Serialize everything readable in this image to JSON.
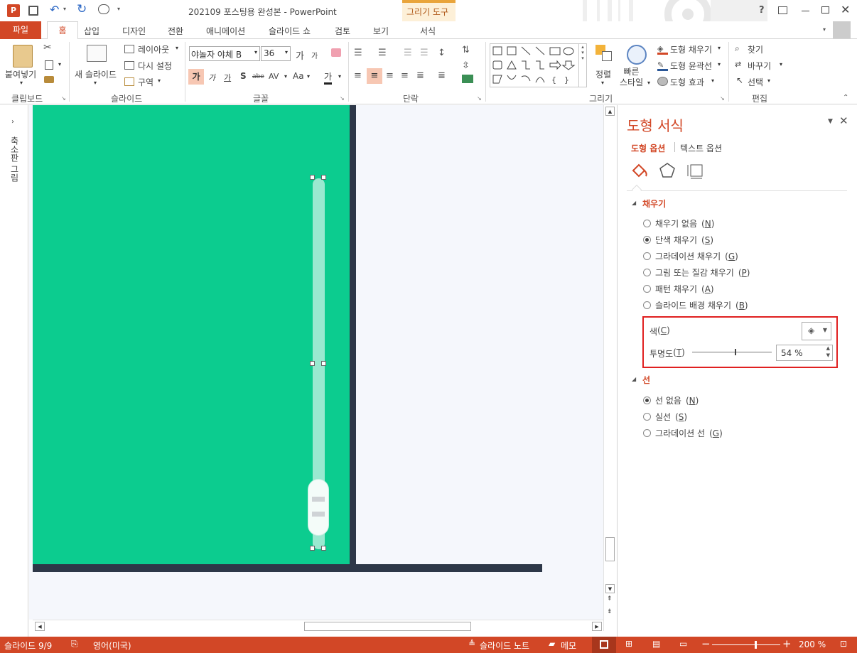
{
  "titlebar": {
    "title": "202109 포스팅용 완성본 - PowerPoint",
    "contextual_group": "그리기 도구",
    "help": "?"
  },
  "tabs": [
    {
      "label": "파일"
    },
    {
      "label": "홈"
    },
    {
      "label": "삽입"
    },
    {
      "label": "디자인"
    },
    {
      "label": "전환"
    },
    {
      "label": "애니메이션"
    },
    {
      "label": "슬라이드 쇼"
    },
    {
      "label": "검토"
    },
    {
      "label": "보기"
    },
    {
      "label": "서식"
    }
  ],
  "ribbon": {
    "clipboard": {
      "paste": "붙여넣기",
      "group": "클립보드"
    },
    "slides": {
      "new_slide": "새 슬라이드",
      "layout": "레이아웃",
      "reset": "다시 설정",
      "section": "구역",
      "group": "슬라이드"
    },
    "font": {
      "font_name": "야놀자 야체 B",
      "font_size": "36",
      "group": "글꼴",
      "grow": "가",
      "shrink": "가",
      "bold": "가",
      "italic": "가",
      "underline": "가",
      "shadow": "S",
      "strike": "abe",
      "spacing": "AV",
      "case": "Aa",
      "color": "가"
    },
    "paragraph": {
      "group": "단락"
    },
    "drawing": {
      "arrange": "정렬",
      "quick_styles": "빠른\n스타일",
      "fill": "도형 채우기",
      "outline": "도형 윤곽선",
      "effects": "도형 효과",
      "group": "그리기"
    },
    "editing": {
      "find": "찾기",
      "replace": "바꾸기",
      "select": "선택",
      "group": "편집"
    }
  },
  "left_rail": {
    "label": "축소판 그림"
  },
  "format_pane": {
    "title": "도형 서식",
    "tab_shape": "도형 옵션",
    "tab_text": "텍스트 옵션",
    "fill_section": "채우기",
    "fill_options": [
      {
        "label": "채우기 없음",
        "key": "N",
        "selected": false
      },
      {
        "label": "단색 채우기",
        "key": "S",
        "selected": true
      },
      {
        "label": "그라데이션 채우기",
        "key": "G",
        "selected": false
      },
      {
        "label": "그림 또는 질감 채우기",
        "key": "P",
        "selected": false
      },
      {
        "label": "패턴 채우기",
        "key": "A",
        "selected": false
      },
      {
        "label": "슬라이드 배경 채우기",
        "key": "B",
        "selected": false
      }
    ],
    "color_label": "색",
    "color_key": "C",
    "transparency_label": "투명도",
    "transparency_key": "T",
    "transparency_value": "54 %",
    "transparency_level": 0.54,
    "line_section": "선",
    "line_options": [
      {
        "label": "선 없음",
        "key": "N",
        "selected": true
      },
      {
        "label": "실선",
        "key": "S",
        "selected": false
      },
      {
        "label": "그라데이션 선",
        "key": "G",
        "selected": false
      }
    ]
  },
  "statusbar": {
    "slide": "슬라이드 9/9",
    "language": "영어(미국)",
    "notes": "슬라이드 노트",
    "comments": "메모",
    "zoom": "200 %"
  },
  "colors": {
    "accent": "#d24726",
    "slide_green": "#0ccc8f",
    "slide_dark": "#2d3748",
    "highlight_box": "#e02020"
  }
}
